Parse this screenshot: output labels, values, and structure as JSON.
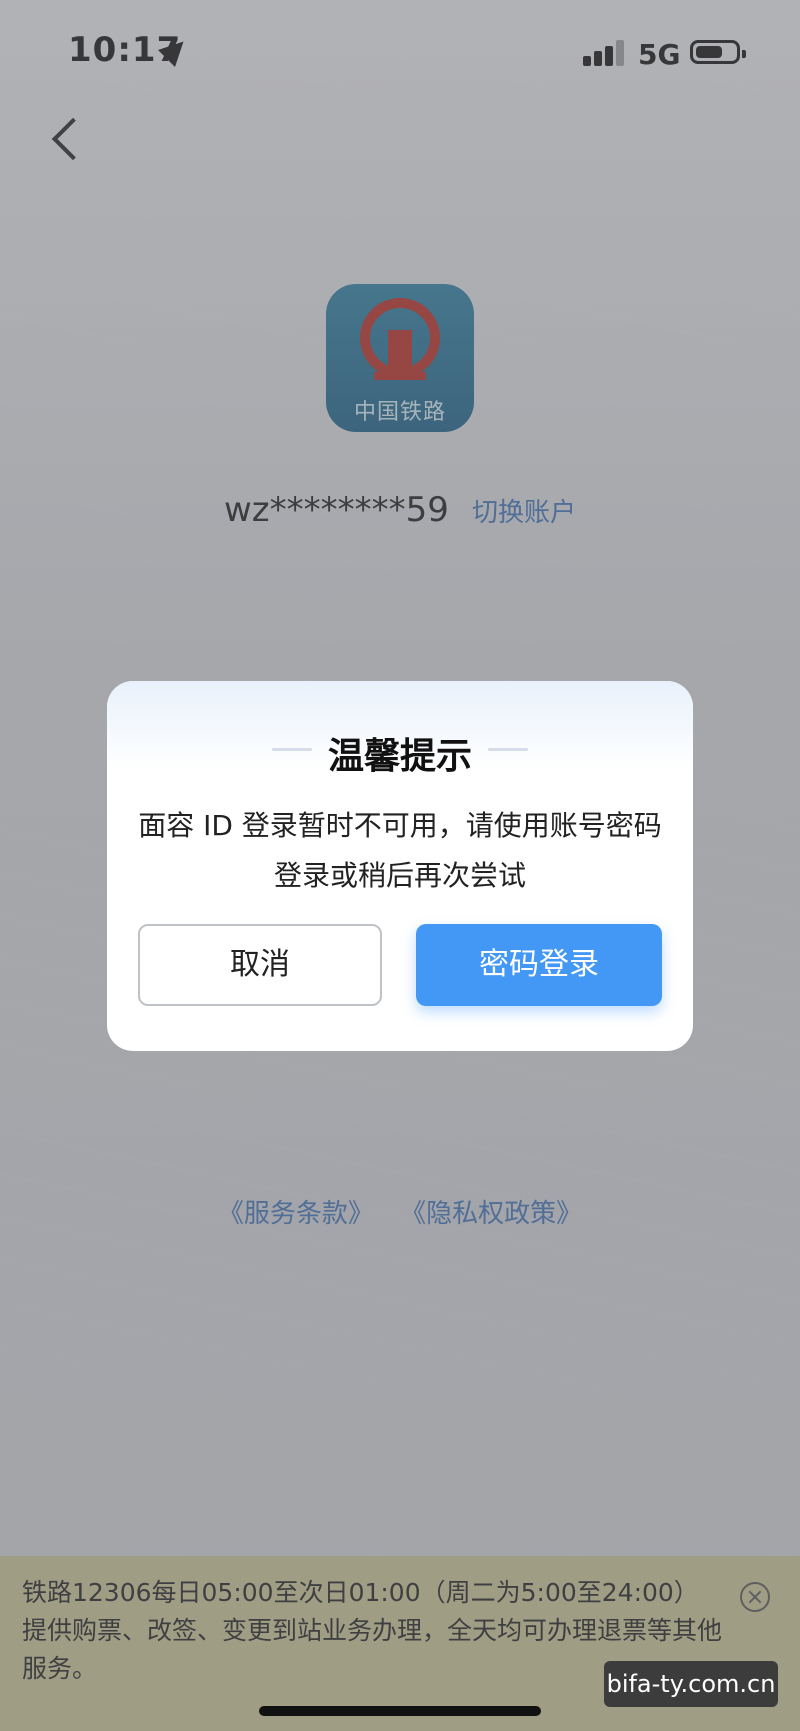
{
  "status": {
    "time": "10:17",
    "network": "5G"
  },
  "logo": {
    "text": "中国铁路"
  },
  "account": {
    "name": "wz********59",
    "switch_label": "切换账户"
  },
  "dialog": {
    "title": "温馨提示",
    "message": "面容 ID 登录暂时不可用，请使用账号密码登录或稍后再次尝试",
    "cancel_label": "取消",
    "confirm_label": "密码登录"
  },
  "links": {
    "terms": "《服务条款》",
    "privacy": "《隐私权政策》"
  },
  "notice": {
    "text": "铁路12306每日05:00至次日01:00（周二为5:00至24:00）提供购票、改签、变更到站业务办理，全天均可办理退票等其他服务。"
  },
  "watermark": "bifa-ty.com.cn",
  "colors": {
    "accent": "#4398f5",
    "link": "#3d6fb0",
    "notice_bg": "#e8e4a0",
    "logo_red": "#b42a22"
  }
}
